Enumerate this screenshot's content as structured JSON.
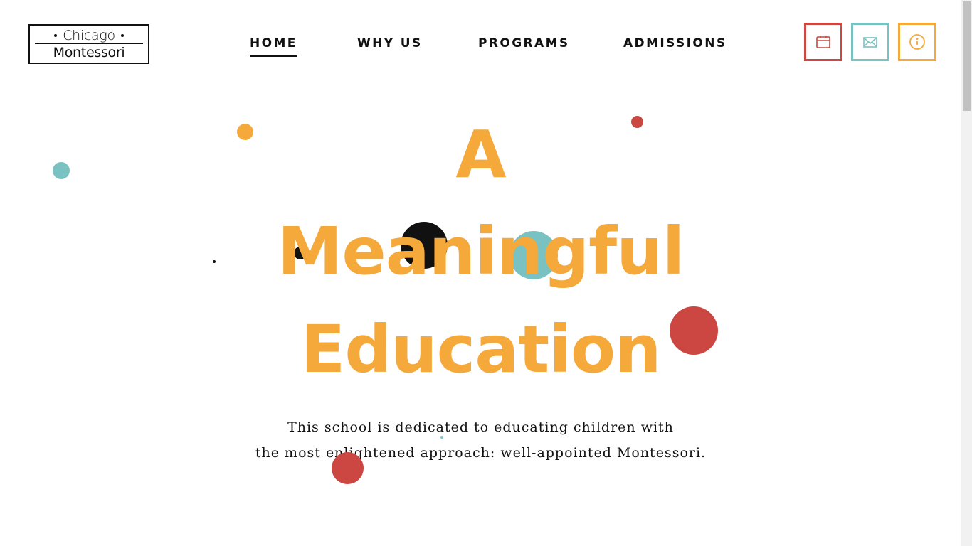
{
  "logo": {
    "top": "Chicago",
    "bottom": "Montessori"
  },
  "nav": [
    {
      "label": "HOME",
      "active": true
    },
    {
      "label": "WHY US",
      "active": false
    },
    {
      "label": "PROGRAMS",
      "active": false
    },
    {
      "label": "ADMISSIONS",
      "active": false
    }
  ],
  "header_buttons": [
    {
      "icon": "calendar-icon",
      "color": "#cc4741"
    },
    {
      "icon": "mail-icon",
      "color": "#7ac2c2"
    },
    {
      "icon": "info-icon",
      "color": "#f4a93a"
    }
  ],
  "hero": {
    "line1": "A",
    "line2": "Meaningful",
    "line3": "Education",
    "copy_line1": "This school is dedicated to educating children with",
    "copy_line2": "the most enlightened approach: well-appointed Montessori."
  },
  "colors": {
    "orange": "#f4a93a",
    "red": "#cc4741",
    "teal": "#7ac2c2",
    "black": "#111111"
  }
}
